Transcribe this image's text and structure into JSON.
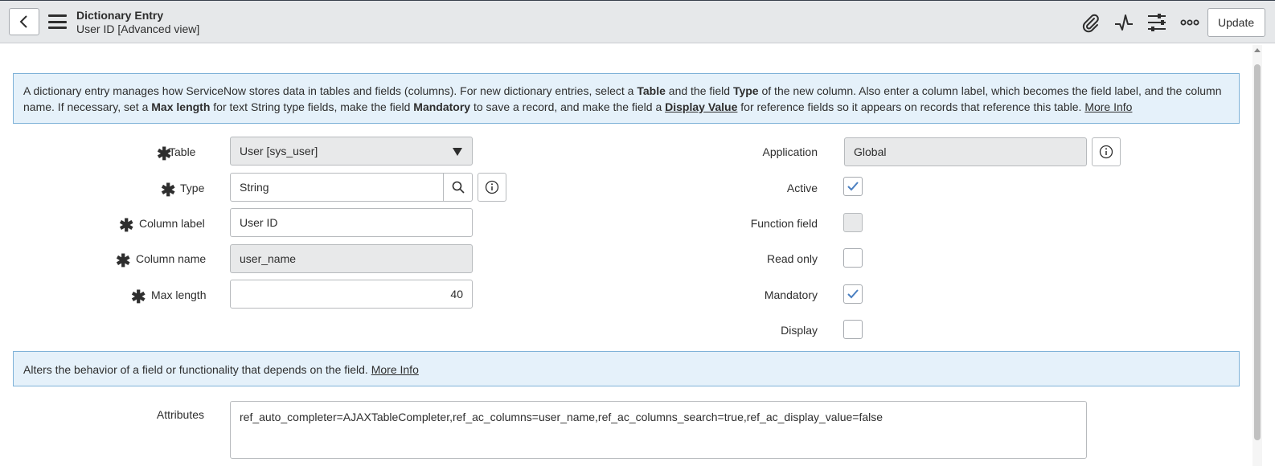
{
  "header": {
    "title": "Dictionary Entry",
    "subtitle": "User ID [Advanced view]",
    "update_label": "Update",
    "icons": [
      "paperclip-icon",
      "activity-icon",
      "sliders-icon",
      "more-icon"
    ]
  },
  "info1": {
    "t1": "A dictionary entry manages how ServiceNow stores data in tables and fields (columns). For new dictionary entries, select a ",
    "b1": "Table",
    "t2": " and the field ",
    "b2": "Type",
    "t3": " of the new column. Also enter a column label, which becomes the field label, and the column name. If necessary, set a ",
    "b3": "Max length",
    "t4": " for text String type fields, make the field ",
    "b4": "Mandatory",
    "t5": " to save a record, and make the field a ",
    "b5": "Display Value",
    "t6": " for reference fields so it appears on records that reference this table. ",
    "link": "More Info"
  },
  "left_fields": {
    "table": {
      "label": "Table",
      "value": "User [sys_user]"
    },
    "type": {
      "label": "Type",
      "value": "String"
    },
    "column_label": {
      "label": "Column label",
      "value": "User ID"
    },
    "column_name": {
      "label": "Column name",
      "value": "user_name"
    },
    "max_length": {
      "label": "Max length",
      "value": "40"
    }
  },
  "right_fields": {
    "application": {
      "label": "Application",
      "value": "Global"
    },
    "active": {
      "label": "Active",
      "checked": true
    },
    "function_field": {
      "label": "Function field",
      "checked": false
    },
    "read_only": {
      "label": "Read only",
      "checked": false
    },
    "mandatory": {
      "label": "Mandatory",
      "checked": true
    },
    "display": {
      "label": "Display",
      "checked": false
    }
  },
  "info2": {
    "text": "Alters the behavior of a field or functionality that depends on the field. ",
    "link": "More Info"
  },
  "attributes": {
    "label": "Attributes",
    "value": "ref_auto_completer=AJAXTableCompleter,ref_ac_columns=user_name,ref_ac_columns_search=true,ref_ac_display_value=false"
  },
  "colors": {
    "accent": "#4a7fc1",
    "info_bg": "#e5f1fa",
    "info_border": "#7fb2d8",
    "header_bg": "#e6e8ea"
  }
}
